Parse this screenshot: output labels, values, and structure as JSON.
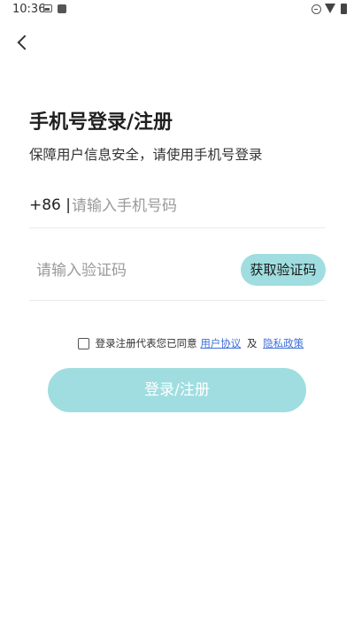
{
  "status_bar": {
    "time": "10:36",
    "icons": [
      "image-icon",
      "download-icon",
      "dnd-icon",
      "wifi-icon",
      "battery-icon"
    ]
  },
  "header": {
    "back_icon": "chevron-left-icon"
  },
  "title": "手机号登录/注册",
  "subtitle": "保障用户信息安全，请使用手机号登录",
  "phone": {
    "country_code": "+86 |",
    "placeholder": "请输入手机号码",
    "value": ""
  },
  "code": {
    "placeholder": "请输入验证码",
    "value": "",
    "get_code_label": "获取验证码"
  },
  "agreement": {
    "checked": false,
    "text": "登录注册代表您已同意",
    "link_terms": "用户协议",
    "and": "及",
    "link_privacy": "隐私政策"
  },
  "submit_label": "登录/注册",
  "colors": {
    "accent": "#9fdde0",
    "link": "#3f6fd8",
    "button_text": "#ffffff"
  }
}
